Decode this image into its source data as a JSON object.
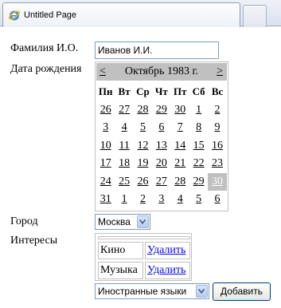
{
  "browser": {
    "tab_title": "Untitled Page"
  },
  "form": {
    "name_label": "Фамилия И.О.",
    "name_value": "Иванов И.И.",
    "dob_label": "Дата рождения",
    "city_label": "Город",
    "city_value": "Москва",
    "interests_label": "Интересы",
    "interest_select_value": "Иностранные языки",
    "add_button": "Добавить"
  },
  "calendar": {
    "prev": "<",
    "next": ">",
    "title": "Октябрь 1983 г.",
    "weekdays": [
      "Пн",
      "Вт",
      "Ср",
      "Чт",
      "Пт",
      "Сб",
      "Вс"
    ],
    "weeks": [
      [
        {
          "d": "26",
          "o": 1
        },
        {
          "d": "27",
          "o": 1
        },
        {
          "d": "28",
          "o": 1
        },
        {
          "d": "29",
          "o": 1
        },
        {
          "d": "30",
          "o": 1
        },
        {
          "d": "1"
        },
        {
          "d": "2"
        }
      ],
      [
        {
          "d": "3"
        },
        {
          "d": "4"
        },
        {
          "d": "5"
        },
        {
          "d": "6"
        },
        {
          "d": "7"
        },
        {
          "d": "8"
        },
        {
          "d": "9"
        }
      ],
      [
        {
          "d": "10"
        },
        {
          "d": "11"
        },
        {
          "d": "12"
        },
        {
          "d": "13"
        },
        {
          "d": "14"
        },
        {
          "d": "15"
        },
        {
          "d": "16"
        }
      ],
      [
        {
          "d": "17"
        },
        {
          "d": "18"
        },
        {
          "d": "19"
        },
        {
          "d": "20"
        },
        {
          "d": "21"
        },
        {
          "d": "22"
        },
        {
          "d": "23"
        }
      ],
      [
        {
          "d": "24"
        },
        {
          "d": "25"
        },
        {
          "d": "26"
        },
        {
          "d": "27"
        },
        {
          "d": "28"
        },
        {
          "d": "29"
        },
        {
          "d": "30",
          "s": 1
        }
      ],
      [
        {
          "d": "31"
        },
        {
          "d": "1",
          "o": 1
        },
        {
          "d": "2",
          "o": 1
        },
        {
          "d": "3",
          "o": 1
        },
        {
          "d": "4",
          "o": 1
        },
        {
          "d": "5",
          "o": 1
        },
        {
          "d": "6",
          "o": 1
        }
      ]
    ]
  },
  "interests": [
    {
      "name": "Кино",
      "action": "Удалить"
    },
    {
      "name": "Музыка",
      "action": "Удалить"
    }
  ],
  "colors": {
    "calendar_header": "#c0c0c0",
    "selected_day": "#c0c0c0",
    "link": "#0000ee"
  }
}
